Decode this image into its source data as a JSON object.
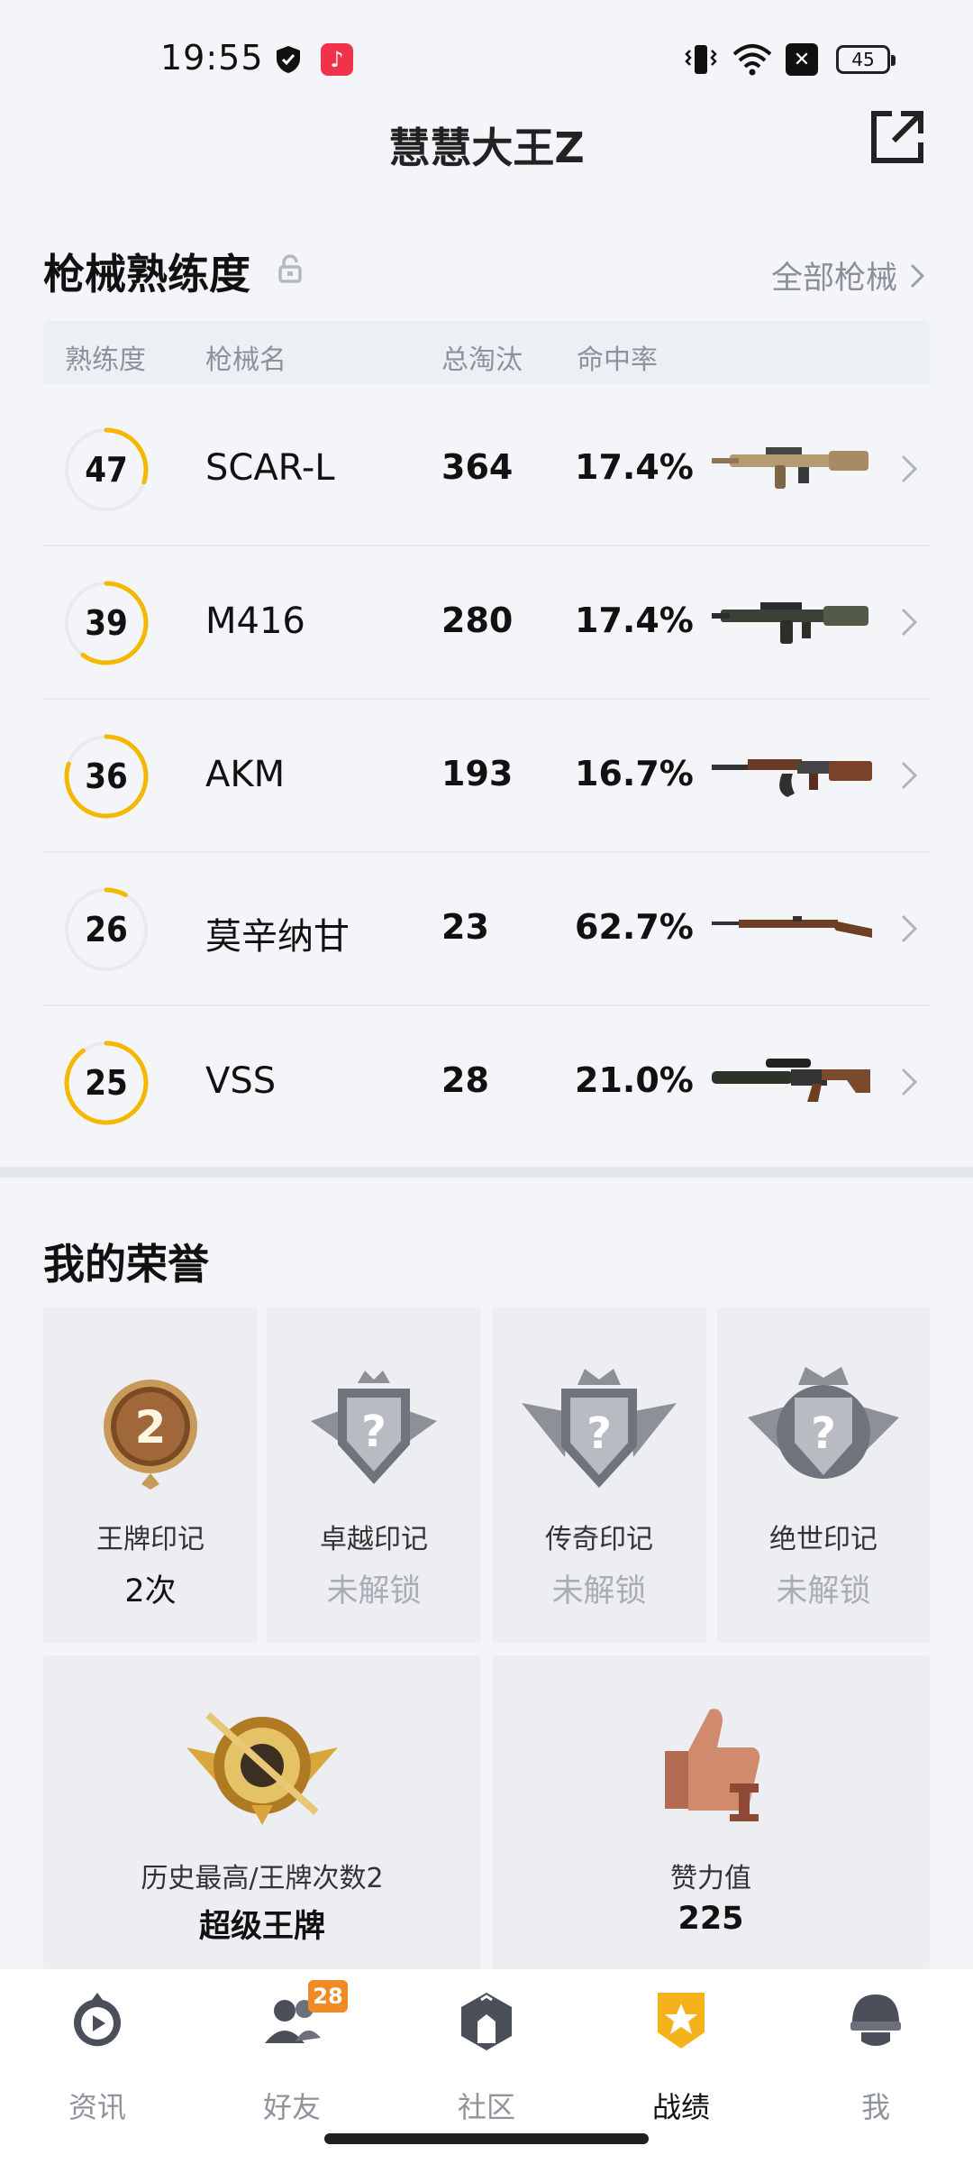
{
  "status_bar": {
    "time": "19:55",
    "battery": "45"
  },
  "header": {
    "title": "慧慧大王Z"
  },
  "weapons": {
    "title": "枪械熟练度",
    "all_label": "全部枪械",
    "columns": [
      "熟练度",
      "枪械名",
      "总淘汰",
      "命中率"
    ],
    "rows": [
      {
        "proficiency": "47",
        "progress": 0.3,
        "name": "SCAR-L",
        "kills": "364",
        "hit_rate": "17.4%",
        "image": "scar-l-rifle-icon"
      },
      {
        "proficiency": "39",
        "progress": 0.6,
        "name": "M416",
        "kills": "280",
        "hit_rate": "17.4%",
        "image": "m416-rifle-icon"
      },
      {
        "proficiency": "36",
        "progress": 0.8,
        "name": "AKM",
        "kills": "193",
        "hit_rate": "16.7%",
        "image": "akm-rifle-icon"
      },
      {
        "proficiency": "26",
        "progress": 0.08,
        "name": "莫辛纳甘",
        "kills": "23",
        "hit_rate": "62.7%",
        "image": "mosin-nagant-icon"
      },
      {
        "proficiency": "25",
        "progress": 0.9,
        "name": "VSS",
        "kills": "28",
        "hit_rate": "21.0%",
        "image": "vss-rifle-icon"
      }
    ]
  },
  "honors": {
    "title": "我的荣誉",
    "cards": [
      {
        "label": "王牌印记",
        "value": "2次",
        "badge_text": "2",
        "icon": "ace-mark-badge-icon"
      },
      {
        "label": "卓越印记",
        "value": "未解锁",
        "icon": "excellence-mark-badge-icon"
      },
      {
        "label": "传奇印记",
        "value": "未解锁",
        "icon": "legend-mark-badge-icon"
      },
      {
        "label": "绝世印记",
        "value": "未解锁",
        "icon": "peerless-mark-badge-icon"
      }
    ],
    "wide_cards": [
      {
        "label": "历史最高/王牌次数2",
        "value": "超级王牌",
        "icon": "super-ace-emblem-icon"
      },
      {
        "label": "赞力值",
        "value": "225",
        "icon": "thumbs-up-trophy-icon"
      }
    ]
  },
  "nav": {
    "items": [
      {
        "label": "资讯",
        "icon": "news-play-icon"
      },
      {
        "label": "好友",
        "icon": "friends-icon",
        "badge": "28"
      },
      {
        "label": "社区",
        "icon": "community-icon"
      },
      {
        "label": "战绩",
        "icon": "record-trophy-icon",
        "active": true
      },
      {
        "label": "我",
        "icon": "helmet-profile-icon"
      }
    ]
  },
  "colors": {
    "accent": "#f5b800",
    "ring_track": "#e8eaee",
    "badge": "#f08a24"
  }
}
